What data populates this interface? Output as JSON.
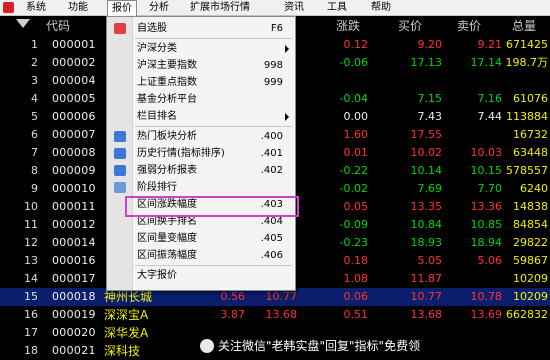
{
  "menubar": {
    "items": [
      "系统",
      "功能",
      "报价",
      "分析",
      "扩展市场行情",
      "资讯",
      "工具",
      "帮助"
    ]
  },
  "columns": {
    "code": "代码",
    "change": "涨跌",
    "bid": "买价",
    "ask": "卖价",
    "volume": "总量"
  },
  "rows": [
    {
      "idx": "1",
      "code": "000001",
      "name": "",
      "change": "0.12",
      "bid": "9.20",
      "ask": "9.21",
      "volume": "671425"
    },
    {
      "idx": "2",
      "code": "000002",
      "name": "",
      "change": "-0.06",
      "bid": "17.13",
      "ask": "17.14",
      "volume": "198.7万"
    },
    {
      "idx": "3",
      "code": "000004",
      "name": "",
      "change": "",
      "bid": "",
      "ask": "",
      "volume": ""
    },
    {
      "idx": "4",
      "code": "000005",
      "name": "",
      "change": "-0.04",
      "bid": "7.15",
      "ask": "7.16",
      "volume": "61076"
    },
    {
      "idx": "5",
      "code": "000006",
      "name": "",
      "change": "0.00",
      "bid": "7.43",
      "ask": "7.44",
      "volume": "113884"
    },
    {
      "idx": "6",
      "code": "000007",
      "name": "",
      "change": "1.60",
      "bid": "17.55",
      "ask": "",
      "volume": "16732"
    },
    {
      "idx": "7",
      "code": "000008",
      "name": "",
      "change": "0.01",
      "bid": "10.02",
      "ask": "10.03",
      "volume": "63448"
    },
    {
      "idx": "8",
      "code": "000009",
      "name": "",
      "change": "-0.22",
      "bid": "10.14",
      "ask": "10.15",
      "volume": "578557"
    },
    {
      "idx": "9",
      "code": "000010",
      "name": "",
      "change": "-0.02",
      "bid": "7.69",
      "ask": "7.70",
      "volume": "6240"
    },
    {
      "idx": "10",
      "code": "000011",
      "name": "",
      "change": "0.05",
      "bid": "13.35",
      "ask": "13.36",
      "volume": "14838"
    },
    {
      "idx": "11",
      "code": "000012",
      "name": "",
      "change": "-0.09",
      "bid": "10.84",
      "ask": "10.85",
      "volume": "84854"
    },
    {
      "idx": "12",
      "code": "000014",
      "name": "",
      "change": "-0.23",
      "bid": "18.93",
      "ask": "18.94",
      "volume": "29822"
    },
    {
      "idx": "13",
      "code": "000016",
      "name": "",
      "change": "0.18",
      "bid": "5.05",
      "ask": "5.06",
      "volume": "59867"
    },
    {
      "idx": "14",
      "code": "000017",
      "name": "",
      "change": "1.08",
      "bid": "11.87",
      "ask": "",
      "volume": "10209"
    },
    {
      "idx": "15",
      "code": "000018",
      "name": "神州长城",
      "v1": "0.56",
      "v2": "10.77",
      "change": "0.06",
      "bid": "10.77",
      "ask": "10.78",
      "volume": "10209"
    },
    {
      "idx": "16",
      "code": "000019",
      "name": "深深宝A",
      "v1": "3.87",
      "v2": "13.68",
      "change": "0.51",
      "bid": "13.68",
      "ask": "13.69",
      "volume": "662832"
    },
    {
      "idx": "17",
      "code": "000020",
      "name": "深华发A",
      "v1": "",
      "v2": "",
      "change": "",
      "bid": "",
      "ask": "",
      "volume": ""
    },
    {
      "idx": "18",
      "code": "000021",
      "name": "深科技",
      "v1": "",
      "v2": "",
      "change": "",
      "bid": "",
      "ask": "",
      "volume": ""
    }
  ],
  "dropdown": {
    "items": [
      {
        "label": "自选股",
        "shortcut": "F6",
        "icon": "self-select-icon"
      },
      {
        "label": "沪深分类",
        "shortcut": "",
        "submenu": true
      },
      {
        "label": "沪深主要指数",
        "shortcut": "998"
      },
      {
        "label": "上证重点指数",
        "shortcut": "999"
      },
      {
        "label": "基金分析平台",
        "shortcut": ""
      },
      {
        "label": "栏目排名",
        "shortcut": "",
        "submenu": true
      },
      {
        "label": "热门板块分析",
        "shortcut": ".400",
        "icon": "hot-sector-icon"
      },
      {
        "label": "历史行情(指标排序)",
        "shortcut": ".401",
        "icon": "history-quotes-icon"
      },
      {
        "label": "强弱分析报表",
        "shortcut": ".402",
        "icon": "strength-report-icon"
      },
      {
        "label": "阶段排行",
        "shortcut": "",
        "icon": "stage-rank-icon"
      },
      {
        "label": "区间涨跌幅度",
        "shortcut": ".403"
      },
      {
        "label": "区间换手排名",
        "shortcut": ".404"
      },
      {
        "label": "区间量变幅度",
        "shortcut": ".405"
      },
      {
        "label": "区间振荡幅度",
        "shortcut": ".406"
      },
      {
        "label": "大字报价",
        "shortcut": ""
      }
    ]
  },
  "watermark": "关注微信\"老韩实盘\"回复\"指标\"免费领",
  "colors": {
    "up": "#ff3232",
    "down": "#00d800",
    "flat": "#eeeeee",
    "name": "#f0f000",
    "highlight_box": "#d040d0"
  }
}
